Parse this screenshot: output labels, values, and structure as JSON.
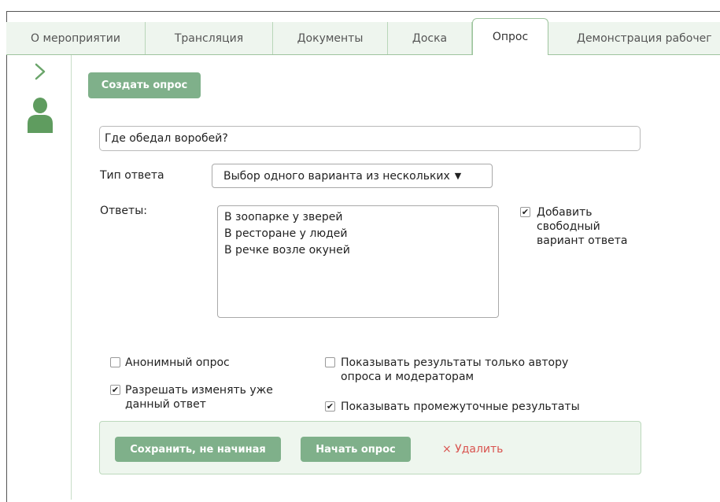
{
  "tabs": [
    {
      "label": "О мероприятии"
    },
    {
      "label": "Трансляция"
    },
    {
      "label": "Документы"
    },
    {
      "label": "Доска"
    },
    {
      "label": "Опрос",
      "active": true
    },
    {
      "label": "Демонстрация рабочег"
    }
  ],
  "sidebar": {
    "expand_icon": "chevron-right-icon",
    "user_icon": "user-icon"
  },
  "form": {
    "create_button": "Создать опрос",
    "question_value": "Где обедал воробей?",
    "answer_type_label": "Тип ответа",
    "answer_type_value": "Выбор одного варианта из нескольких",
    "answers_label": "Ответы:",
    "answers": [
      "В зоопарке у зверей",
      "В ресторане у людей",
      "В речке возле окуней"
    ],
    "add_free_answer": {
      "lines": [
        "Добавить",
        "свободный",
        "вариант ответа"
      ],
      "checked": true
    },
    "anonymous": {
      "label": "Анонимный опрос",
      "checked": false
    },
    "allow_change": {
      "lines": [
        "Разрешать изменять уже",
        "данный ответ"
      ],
      "checked": true
    },
    "results_author_only": {
      "lines": [
        "Показывать результаты только автору",
        "опроса и модераторам"
      ],
      "checked": false
    },
    "show_intermediate": {
      "label": "Показывать промежуточные результаты",
      "checked": true
    }
  },
  "actions": {
    "save_button": "Сохранить, не начиная",
    "start_button": "Начать опрос",
    "delete_link": "× Удалить"
  },
  "colors": {
    "accent": "#7fb08a",
    "tab_bg": "#eef5ee",
    "delete": "#d9534f"
  }
}
